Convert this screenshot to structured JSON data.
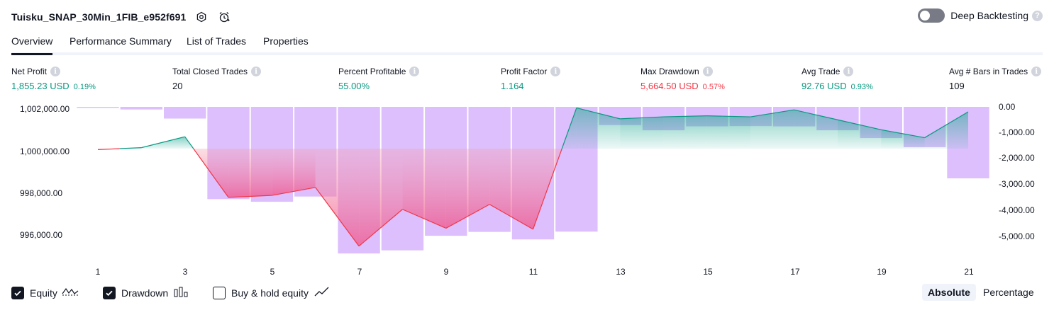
{
  "header": {
    "title": "Tuisku_SNAP_30Min_1FIB_e952f691",
    "deep_backtesting_label": "Deep Backtesting"
  },
  "tabs": [
    {
      "label": "Overview",
      "active": true
    },
    {
      "label": "Performance Summary",
      "active": false
    },
    {
      "label": "List of Trades",
      "active": false
    },
    {
      "label": "Properties",
      "active": false
    }
  ],
  "metrics": [
    {
      "label": "Net Profit",
      "value": "1,855.23 USD",
      "pct": "0.19%",
      "color": "green"
    },
    {
      "label": "Total Closed Trades",
      "value": "20",
      "pct": "",
      "color": "dark"
    },
    {
      "label": "Percent Profitable",
      "value": "55.00%",
      "pct": "",
      "color": "green"
    },
    {
      "label": "Profit Factor",
      "value": "1.164",
      "pct": "",
      "color": "green"
    },
    {
      "label": "Max Drawdown",
      "value": "5,664.50 USD",
      "pct": "0.57%",
      "color": "red"
    },
    {
      "label": "Avg Trade",
      "value": "92.76 USD",
      "pct": "0.93%",
      "color": "green"
    },
    {
      "label": "Avg # Bars in Trades",
      "value": "109",
      "pct": "",
      "color": "dark"
    }
  ],
  "chart_data": {
    "type": "line",
    "x": [
      1,
      2,
      3,
      4,
      5,
      6,
      7,
      8,
      9,
      10,
      11,
      12,
      13,
      14,
      15,
      16,
      17,
      18,
      19,
      20,
      21
    ],
    "x_tick_labels": [
      "1",
      "3",
      "5",
      "7",
      "9",
      "11",
      "13",
      "15",
      "17",
      "19",
      "21"
    ],
    "left_axis_ticks": [
      "1,002,000.00",
      "1,000,000.00",
      "998,000.00",
      "996,000.00"
    ],
    "right_axis_ticks": [
      "0.00",
      "-1,000.00",
      "-2,000.00",
      "-3,000.00",
      "-4,000.00",
      "-5,000.00"
    ],
    "series": [
      {
        "name": "Equity",
        "values": [
          999950,
          1000050,
          1000600,
          997550,
          997650,
          998050,
          995100,
          996950,
          996000,
          997200,
          995950,
          1002050,
          1001500,
          1001600,
          1001650,
          1001600,
          1001950,
          1001450,
          1000950,
          1000550,
          1001850
        ],
        "color": "#089981",
        "drawdown_color": "#f23645"
      },
      {
        "name": "Drawdown",
        "values": [
          -20,
          -100,
          -450,
          -3550,
          -3650,
          -3450,
          -5640,
          -5520,
          -4960,
          -4810,
          -5100,
          -4800,
          -700,
          -900,
          -750,
          -740,
          -750,
          -900,
          -1200,
          -1550,
          -2750
        ],
        "color": "#d6b4fc"
      }
    ],
    "ylim_left": [
      994700,
      1002100
    ],
    "ylim_right": [
      -5664.5,
      0
    ],
    "baseline_equity": 1000000
  },
  "legend": {
    "equity_label": "Equity",
    "drawdown_label": "Drawdown",
    "buyhold_label": "Buy & hold equity",
    "equity_checked": true,
    "drawdown_checked": true,
    "buyhold_checked": false
  },
  "view_toggle": {
    "absolute": "Absolute",
    "percentage": "Percentage",
    "selected": "Absolute"
  }
}
